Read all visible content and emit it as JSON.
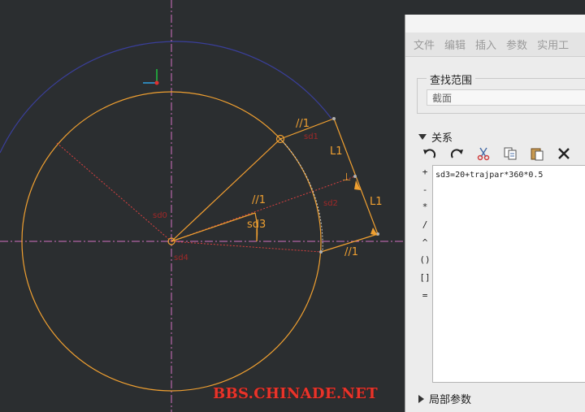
{
  "sketch": {
    "dim_parallel_1": "//1",
    "dim_parallel_2": "//1",
    "dim_parallel_3": "//1",
    "dim_length_1": "L1",
    "dim_length_2": "L1",
    "dim_angle": "sd3",
    "perpendicular_symbol": "⊥",
    "colors": {
      "background": "#2b2e30",
      "inner_circle": "#f0a030",
      "outer_arc": "#3a3f9a",
      "centerline": "#d070c0",
      "construction": "#d94040",
      "geometry": "#f0a030"
    }
  },
  "panel": {
    "menu": [
      "文件",
      "编辑",
      "插入",
      "参数",
      "实用工"
    ],
    "find_scope": {
      "title": "查找范围",
      "value": "截面"
    },
    "relations": {
      "title": "关系",
      "toolbar_icons": [
        "undo-icon",
        "redo-icon",
        "cut-icon",
        "copy-icon",
        "paste-icon",
        "delete-icon",
        "sort-icon"
      ],
      "operators": [
        "+",
        "-",
        "*",
        "/",
        "^",
        "()",
        "[]",
        "="
      ],
      "editor_text": "sd3=20+trajpar*360*0.5"
    },
    "local_params_label": "局部参数"
  },
  "watermark": "BBS.CHINADE.NET"
}
